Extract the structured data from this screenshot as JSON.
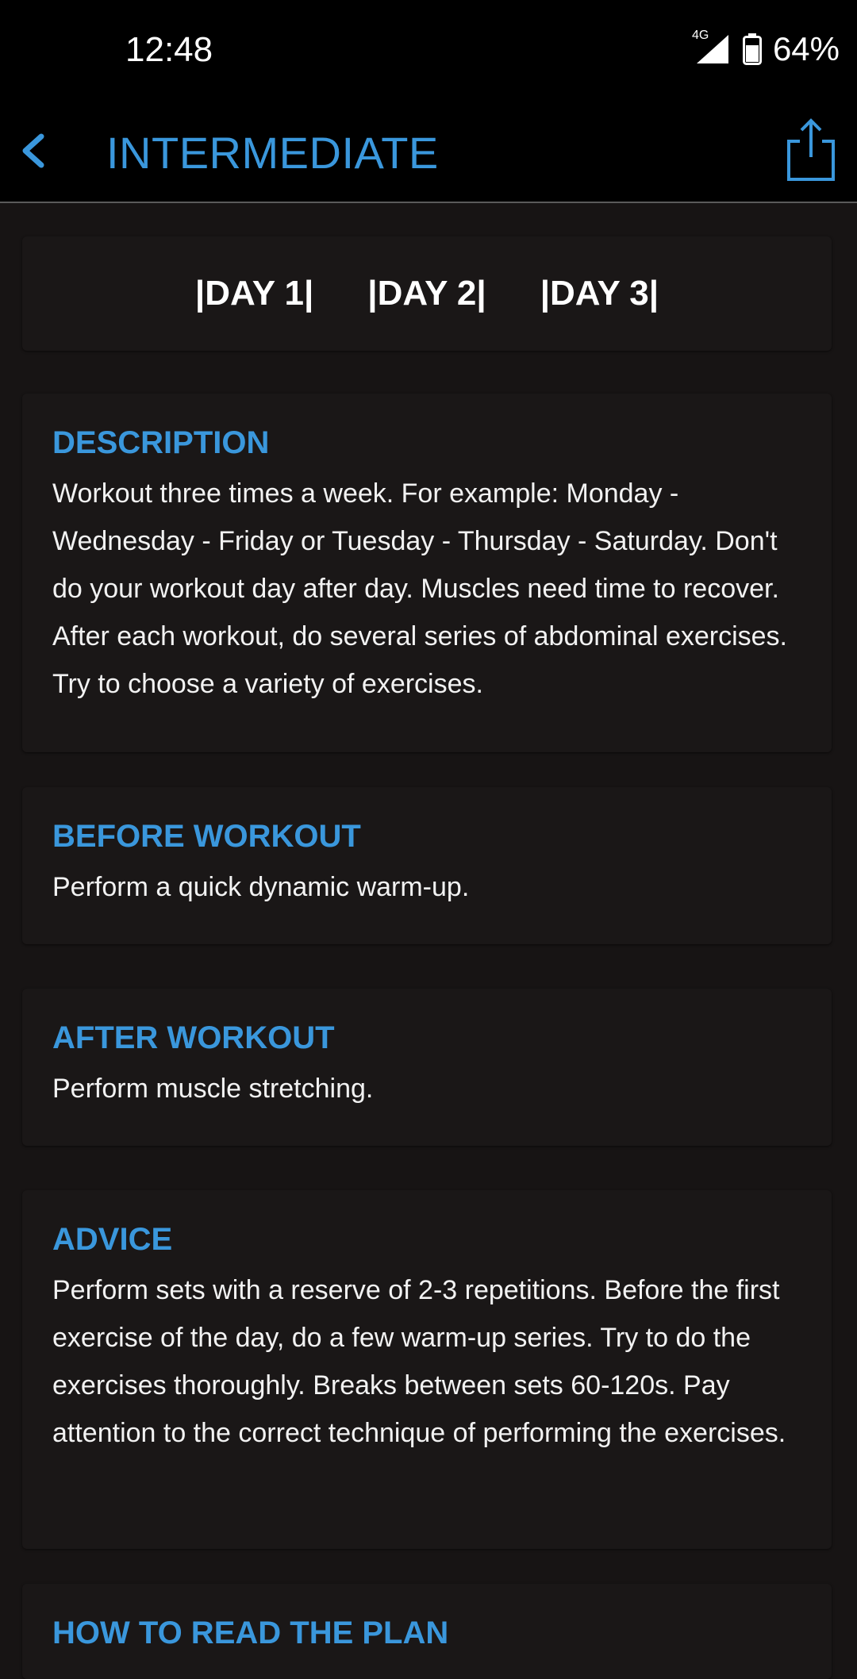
{
  "status": {
    "time": "12:48",
    "network": "4G",
    "battery": "64%"
  },
  "appbar": {
    "title": "INTERMEDIATE",
    "back_icon": "chevron-left-icon",
    "share_icon": "share-icon"
  },
  "day_tabs": [
    "|DAY 1|",
    "|DAY 2|",
    "|DAY 3|"
  ],
  "sections": {
    "description": {
      "title": "DESCRIPTION",
      "body": "Workout three times a week. For example: Monday - Wednesday - Friday or Tuesday - Thursday - Saturday. Don't do your workout day after day. Muscles need time to recover. After each workout, do several series of abdominal exercises. Try to choose a variety of exercises."
    },
    "before_workout": {
      "title": "BEFORE WORKOUT",
      "body": "Perform a quick dynamic warm-up."
    },
    "after_workout": {
      "title": "AFTER WORKOUT",
      "body": "Perform muscle stretching."
    },
    "advice": {
      "title": "ADVICE",
      "body": "Perform sets with a reserve of 2-3 repetitions. Before the first exercise of the day, do a few warm-up series. Try to do the exercises thoroughly. Breaks between sets 60-120s. Pay attention to the correct technique of performing the exercises."
    },
    "how_to_read": {
      "title": "HOW TO READ THE PLAN"
    }
  },
  "colors": {
    "accent": "#3a97dc",
    "background": "#171414",
    "card": "#1a1717",
    "bar": "#000000"
  }
}
